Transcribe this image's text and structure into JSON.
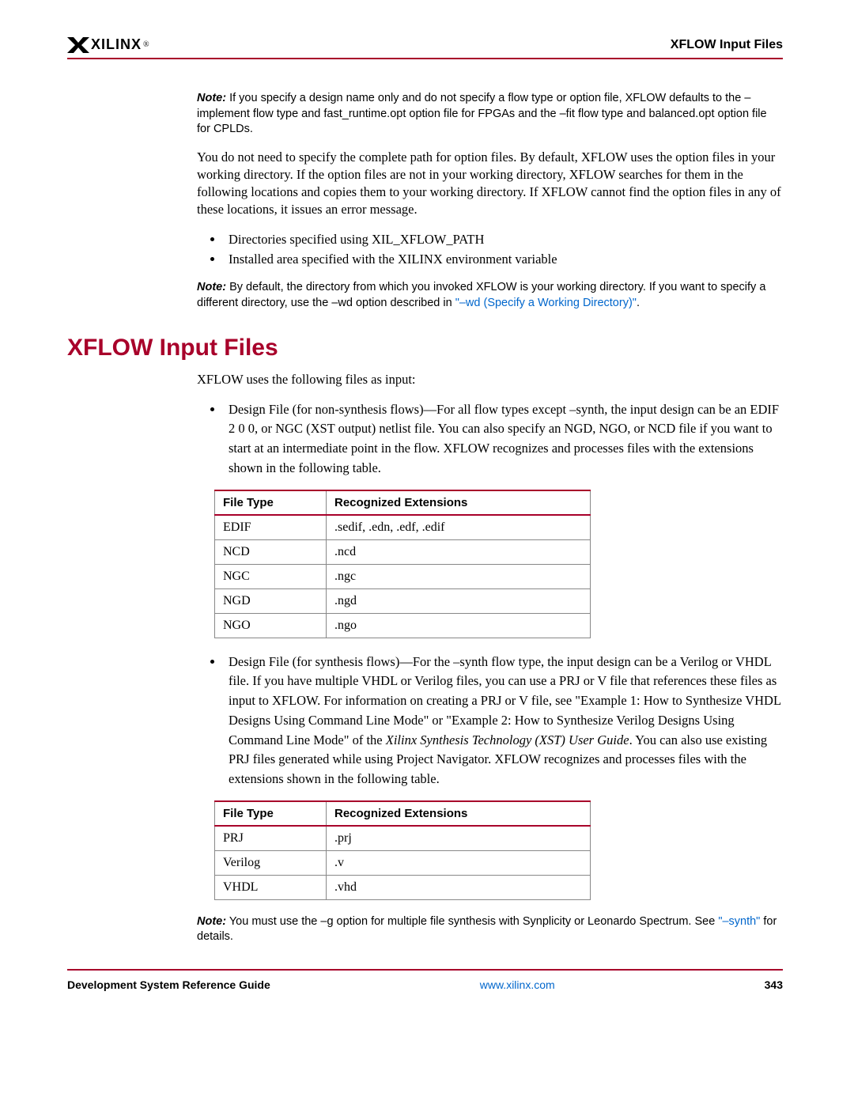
{
  "header": {
    "logo_text": "XILINX",
    "logo_reg": "®",
    "title": "XFLOW Input Files"
  },
  "note1": {
    "label": "Note:",
    "text": "If you specify a design name only and do not specify a flow type or option file, XFLOW defaults to the –implement flow type and fast_runtime.opt option file for FPGAs and the –fit flow type and balanced.opt option file for CPLDs."
  },
  "para1": "You do not need to specify the complete path for option files. By default, XFLOW uses the option files in your working directory. If the option files are not in your working directory, XFLOW searches for them in the following locations and copies them to your working directory. If XFLOW cannot find the option files in any of these locations, it issues an error message.",
  "bullets1": [
    "Directories specified using XIL_XFLOW_PATH",
    "Installed area specified with the XILINX environment variable"
  ],
  "note2": {
    "label": "Note:",
    "text_before": "By default, the directory from which you invoked XFLOW is your working directory. If you want to specify a different directory, use the –wd option described in ",
    "link": "\"–wd (Specify a Working Directory)\"",
    "text_after": "."
  },
  "section_heading": "XFLOW Input Files",
  "para2": "XFLOW uses the following files as input:",
  "bullet_design1": "Design File (for non-synthesis flows)—For all flow types except –synth, the input design can be an EDIF 2 0 0, or NGC (XST output) netlist file. You can also specify an NGD, NGO, or NCD file if you want to start at an intermediate point in the flow. XFLOW recognizes and processes files with the extensions shown in the following table.",
  "table1": {
    "headers": [
      "File Type",
      "Recognized Extensions"
    ],
    "rows": [
      [
        "EDIF",
        ".sedif, .edn, .edf, .edif"
      ],
      [
        "NCD",
        ".ncd"
      ],
      [
        "NGC",
        ".ngc"
      ],
      [
        "NGD",
        ".ngd"
      ],
      [
        "NGO",
        ".ngo"
      ]
    ]
  },
  "bullet_design2_a": "Design File (for synthesis flows)—For the –synth flow type, the input design can be a Verilog or VHDL file. If you have multiple VHDL or Verilog files, you can use a PRJ or V file that references these files as input to XFLOW. For information on creating a PRJ or V file, see \"Example 1: How to Synthesize VHDL Designs Using Command Line Mode\" or \"Example 2: How to Synthesize Verilog Designs Using Command Line Mode\" of the ",
  "bullet_design2_italic": "Xilinx Synthesis Technology (XST) User Guide",
  "bullet_design2_b": ". You can also use existing PRJ files generated while using Project Navigator. XFLOW recognizes and processes files with the extensions shown in the following table.",
  "table2": {
    "headers": [
      "File Type",
      "Recognized Extensions"
    ],
    "rows": [
      [
        "PRJ",
        ".prj"
      ],
      [
        "Verilog",
        ".v"
      ],
      [
        "VHDL",
        ".vhd"
      ]
    ]
  },
  "note3": {
    "label": "Note:",
    "text_before": "You must use the –g option for multiple file synthesis with Synplicity or Leonardo Spectrum. See ",
    "link": "\"–synth\"",
    "text_after": " for details."
  },
  "footer": {
    "left": "Development System Reference Guide",
    "center": "www.xilinx.com",
    "right": "343"
  }
}
